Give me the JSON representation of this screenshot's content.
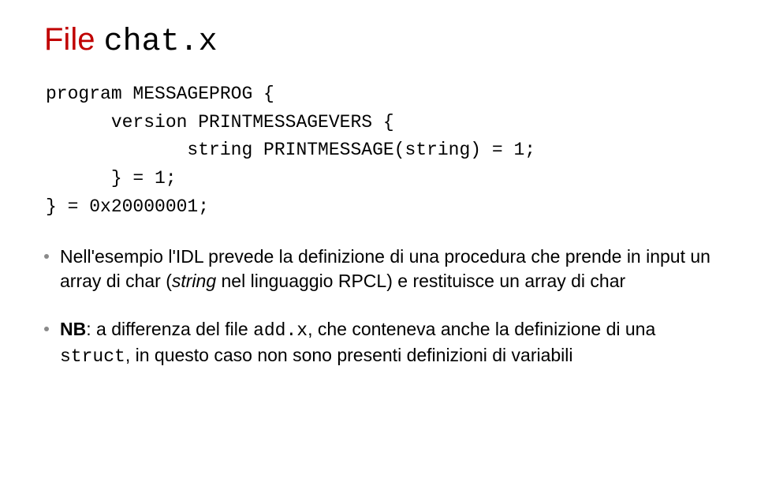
{
  "title": {
    "prefix": "File ",
    "filename": "chat.x"
  },
  "code": "program MESSAGEPROG {\n      version PRINTMESSAGEVERS {\n             string PRINTMESSAGE(string) = 1;\n      } = 1;\n} = 0x20000001;",
  "bullets": [
    {
      "parts": [
        {
          "text": "Nell'esempio l'IDL prevede la definizione di una procedura che prende in input un array di char ("
        },
        {
          "text": "string",
          "style": "italic"
        },
        {
          "text": " nel linguaggio RPCL) e restituisce un array di char"
        }
      ]
    },
    {
      "parts": [
        {
          "text": "NB",
          "style": "bold"
        },
        {
          "text": ": a differenza del file "
        },
        {
          "text": "add.x",
          "style": "mono"
        },
        {
          "text": ", che conteneva anche la definizione di una "
        },
        {
          "text": "struct",
          "style": "mono"
        },
        {
          "text": ", in questo caso non sono presenti definizioni di variabili"
        }
      ]
    }
  ]
}
